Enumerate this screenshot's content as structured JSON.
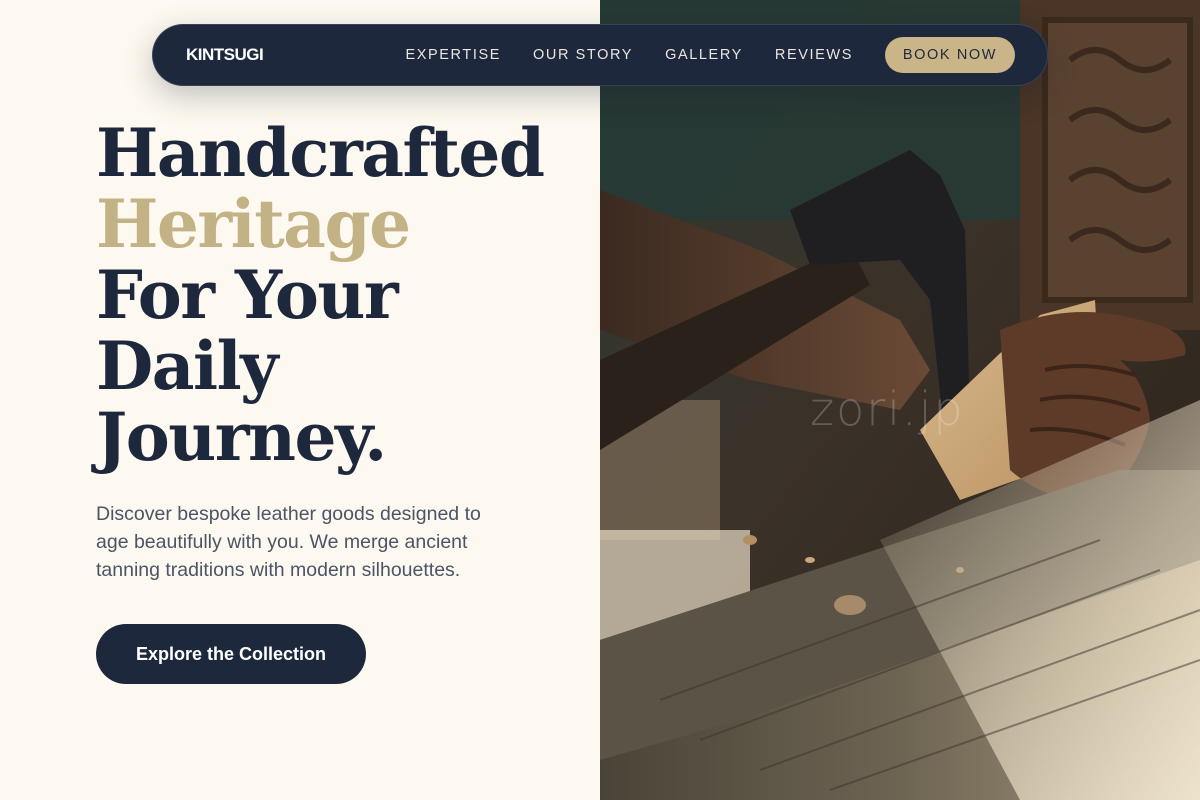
{
  "nav": {
    "brand": "KINTSUGI",
    "links": [
      "EXPERTISE",
      "OUR STORY",
      "GALLERY",
      "REVIEWS"
    ],
    "cta": "BOOK NOW"
  },
  "hero": {
    "headline": {
      "line1": "Handcrafted",
      "line2": "Heritage",
      "line3": "For Your",
      "line4": "Daily",
      "line5": "Journey."
    },
    "description": "Discover bespoke leather goods designed to age beautifully with you. We merge ancient tanning traditions with modern silhouettes.",
    "cta": "Explore the Collection",
    "image_watermark": "zori.jp"
  },
  "colors": {
    "navy": "#1e283d",
    "gold": "#c9b587",
    "accent_text": "#c2b286",
    "cream": "#fdf9f0",
    "body_text": "#4b5566"
  },
  "icons": {
    "hero_image": "craftsman-carving-wood-photo"
  }
}
